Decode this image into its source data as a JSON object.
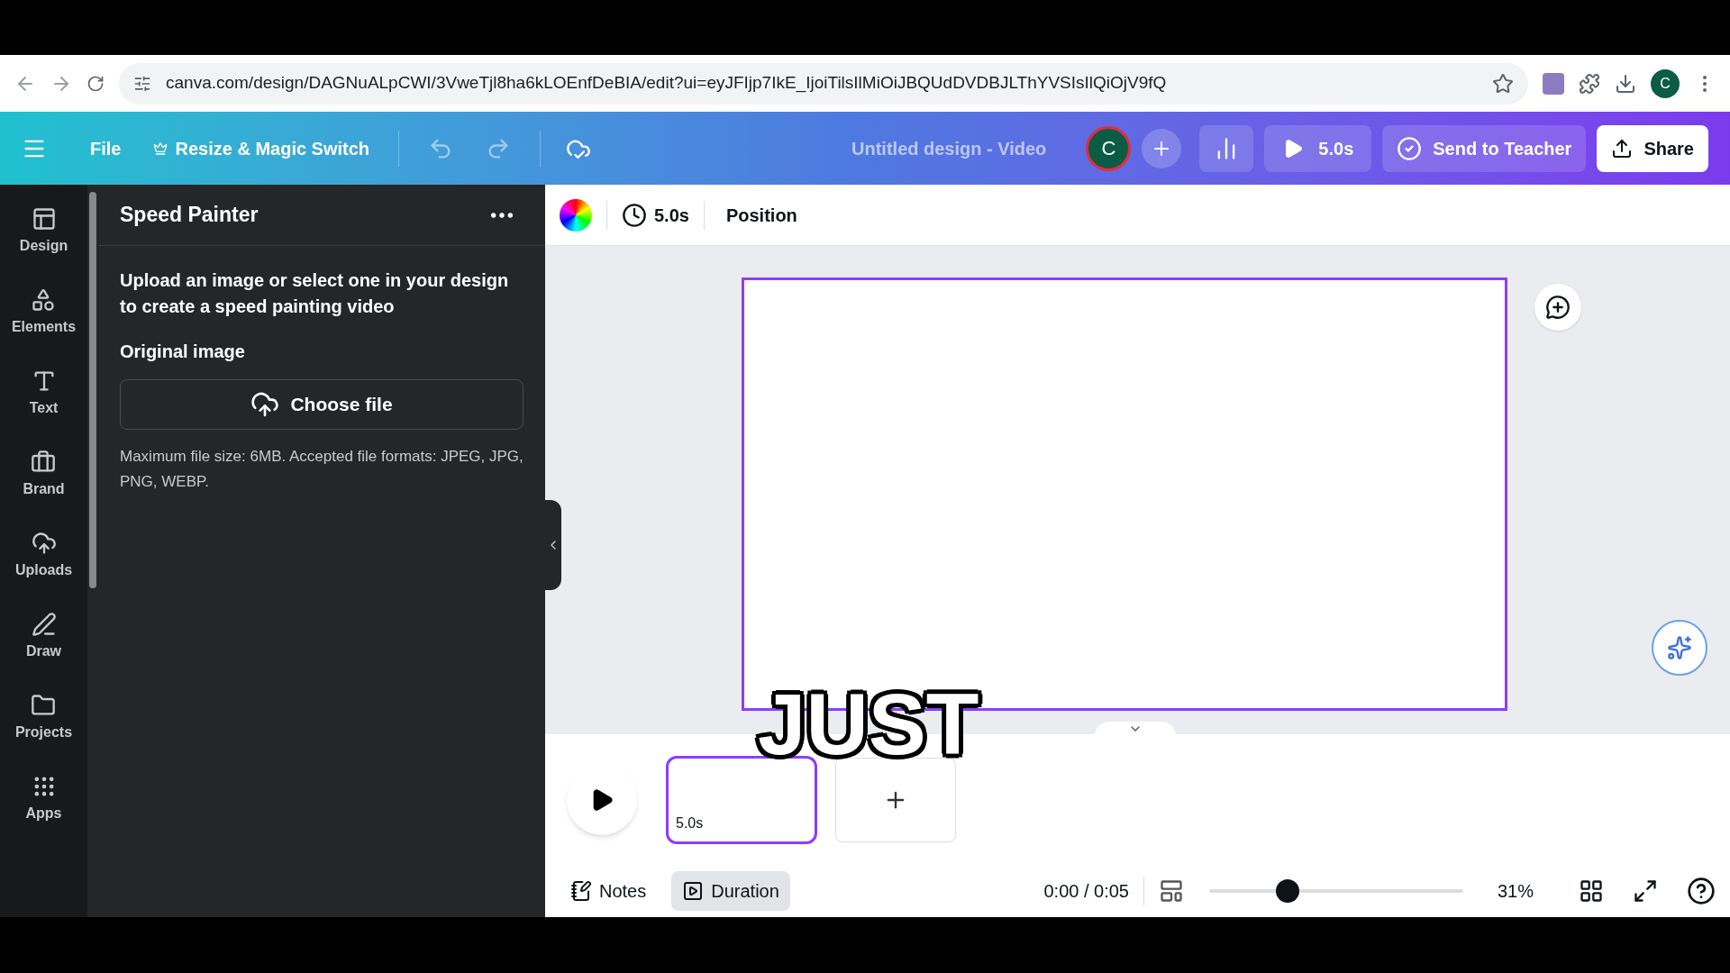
{
  "browser": {
    "url": "canva.com/design/DAGNuALpCWI/3VweTjl8ha6kLOEnfDeBIA/edit?ui=eyJFIjp7IkE_IjoiTilsIlMiOiJBQUdDVDBJLThYVSIsIlQiOjV9fQ",
    "avatar": "C"
  },
  "header": {
    "menu": "File",
    "resize": "Resize & Magic Switch",
    "title": "Untitled design - Video",
    "avatar": "C",
    "play": "5.0s",
    "send": "Send to Teacher",
    "share": "Share"
  },
  "rail": [
    {
      "label": "Design",
      "kind": "design"
    },
    {
      "label": "Elements",
      "kind": "elements"
    },
    {
      "label": "Text",
      "kind": "text"
    },
    {
      "label": "Brand",
      "kind": "brand"
    },
    {
      "label": "Uploads",
      "kind": "uploads"
    },
    {
      "label": "Draw",
      "kind": "draw"
    },
    {
      "label": "Projects",
      "kind": "projects"
    },
    {
      "label": "Apps",
      "kind": "apps"
    }
  ],
  "panel": {
    "title": "Speed Painter",
    "intro": "Upload an image or select one in your design to create a speed painting video",
    "section": "Original image",
    "button": "Choose file",
    "hint": "Maximum file size: 6MB. Accepted file formats: JPEG, JPG, PNG, WEBP."
  },
  "toolbar": {
    "duration": "5.0s",
    "position": "Position"
  },
  "caption": "JUST",
  "timeline": {
    "pages": [
      {
        "duration": "5.0s",
        "selected": true
      }
    ]
  },
  "bottom": {
    "buttons": [
      {
        "label": "Notes",
        "kind": "notes",
        "selected": false
      },
      {
        "label": "Duration",
        "kind": "duration",
        "selected": true
      }
    ],
    "time": "0:00 / 0:05",
    "zoom": {
      "level": 0.31
    },
    "zoom_reading": "31%"
  }
}
